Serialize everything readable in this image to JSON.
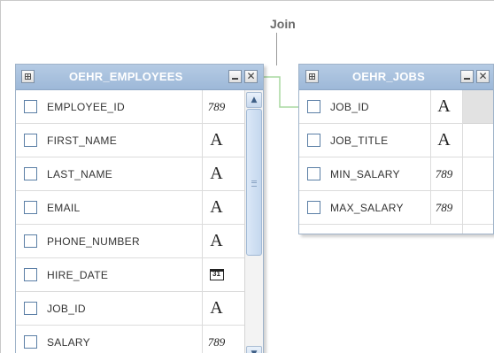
{
  "join": {
    "label": "Join"
  },
  "tables": [
    {
      "title": "OEHR_EMPLOYEES",
      "columns": [
        {
          "name": "EMPLOYEE_ID",
          "type": "number",
          "type_glyph": "789"
        },
        {
          "name": "FIRST_NAME",
          "type": "varchar",
          "type_glyph": "A"
        },
        {
          "name": "LAST_NAME",
          "type": "varchar",
          "type_glyph": "A"
        },
        {
          "name": "EMAIL",
          "type": "varchar",
          "type_glyph": "A"
        },
        {
          "name": "PHONE_NUMBER",
          "type": "varchar",
          "type_glyph": "A"
        },
        {
          "name": "HIRE_DATE",
          "type": "date",
          "type_glyph": "31"
        },
        {
          "name": "JOB_ID",
          "type": "varchar",
          "type_glyph": "A"
        },
        {
          "name": "SALARY",
          "type": "number",
          "type_glyph": "789"
        }
      ]
    },
    {
      "title": "OEHR_JOBS",
      "columns": [
        {
          "name": "JOB_ID",
          "type": "varchar",
          "type_glyph": "A"
        },
        {
          "name": "JOB_TITLE",
          "type": "varchar",
          "type_glyph": "A"
        },
        {
          "name": "MIN_SALARY",
          "type": "number",
          "type_glyph": "789"
        },
        {
          "name": "MAX_SALARY",
          "type": "number",
          "type_glyph": "789"
        }
      ]
    }
  ],
  "icons": {
    "table_menu": "grid-icon",
    "minimize": "minimize-icon",
    "close": "close-icon",
    "close_glyph": "✕",
    "scroll_up": "chevron-up-icon",
    "scroll_up_glyph": "▲",
    "scroll_down": "chevron-down-icon",
    "scroll_down_glyph": "▼"
  },
  "colors": {
    "header_top": "#b5cbe4",
    "header_bottom": "#9db8d8",
    "checkbox_border": "#5b7fa6",
    "join_line": "#a8d8a0"
  }
}
